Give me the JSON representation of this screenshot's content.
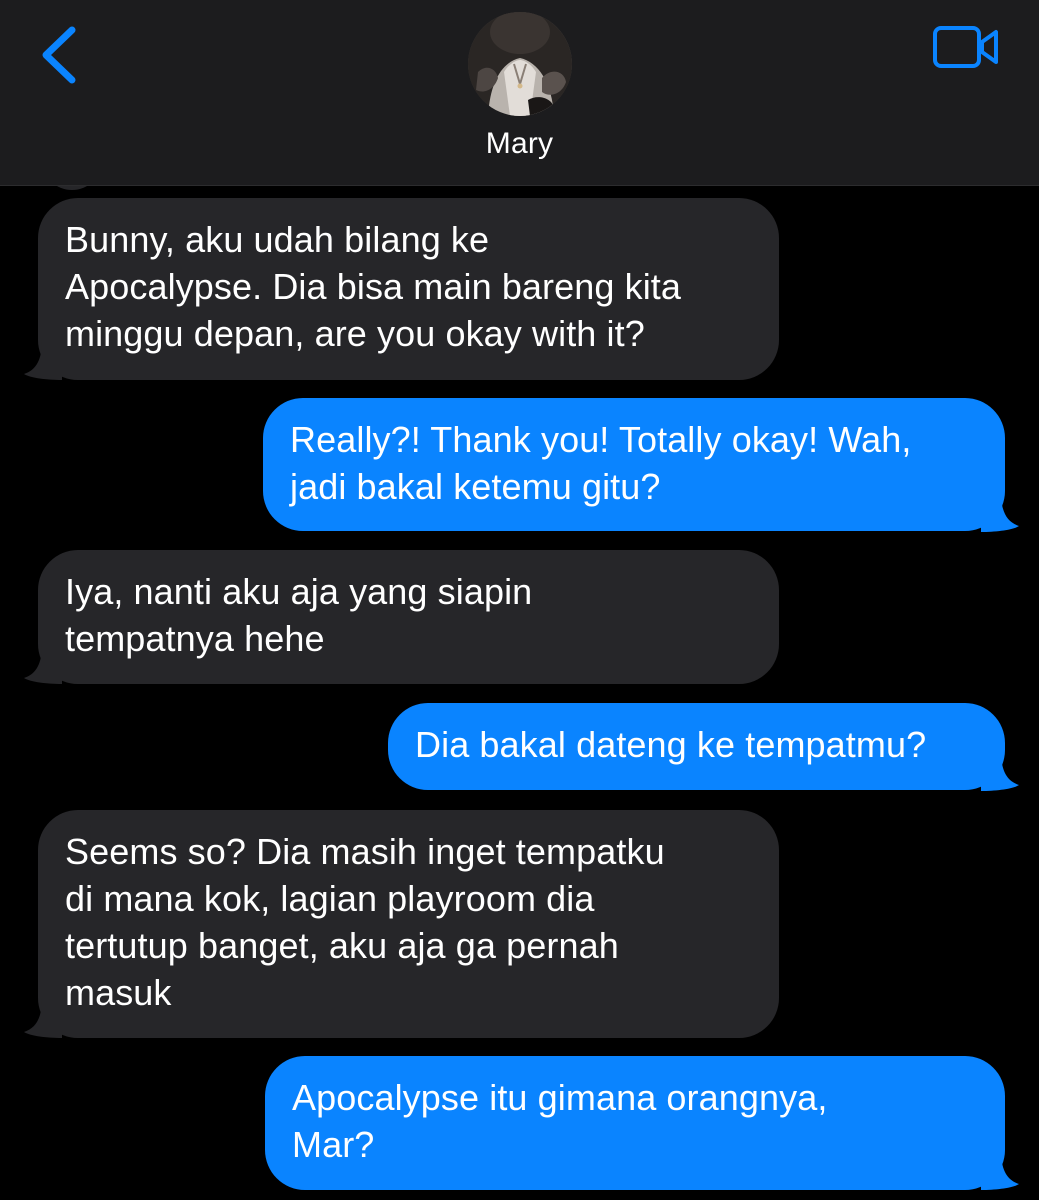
{
  "header": {
    "contact_name": "Mary",
    "back_icon": "chevron-left-icon",
    "video_icon": "video-camera-icon",
    "accent_color": "#0a84ff"
  },
  "colors": {
    "incoming_bubble": "#262629",
    "outgoing_bubble": "#0a84ff",
    "background": "#000000",
    "header_background": "#1c1c1e"
  },
  "messages": [
    {
      "direction": "incoming",
      "lines": [
        "Bunny, aku udah bilang ke",
        "Apocalypse. Dia bisa main bareng kita",
        "minggu depan, are you okay with it?"
      ]
    },
    {
      "direction": "outgoing",
      "lines": [
        "Really?! Thank you! Totally okay! Wah,",
        "jadi bakal ketemu gitu?"
      ]
    },
    {
      "direction": "incoming",
      "lines": [
        "Iya, nanti aku aja yang siapin",
        "tempatnya hehe"
      ]
    },
    {
      "direction": "outgoing",
      "lines": [
        "Dia bakal dateng ke tempatmu?"
      ]
    },
    {
      "direction": "incoming",
      "lines": [
        "Seems so? Dia masih inget tempatku",
        "di mana kok, lagian playroom dia",
        "tertutup banget, aku aja ga pernah",
        "masuk"
      ]
    },
    {
      "direction": "outgoing",
      "lines": [
        "Apocalypse itu gimana orangnya,",
        "Mar?"
      ]
    }
  ]
}
